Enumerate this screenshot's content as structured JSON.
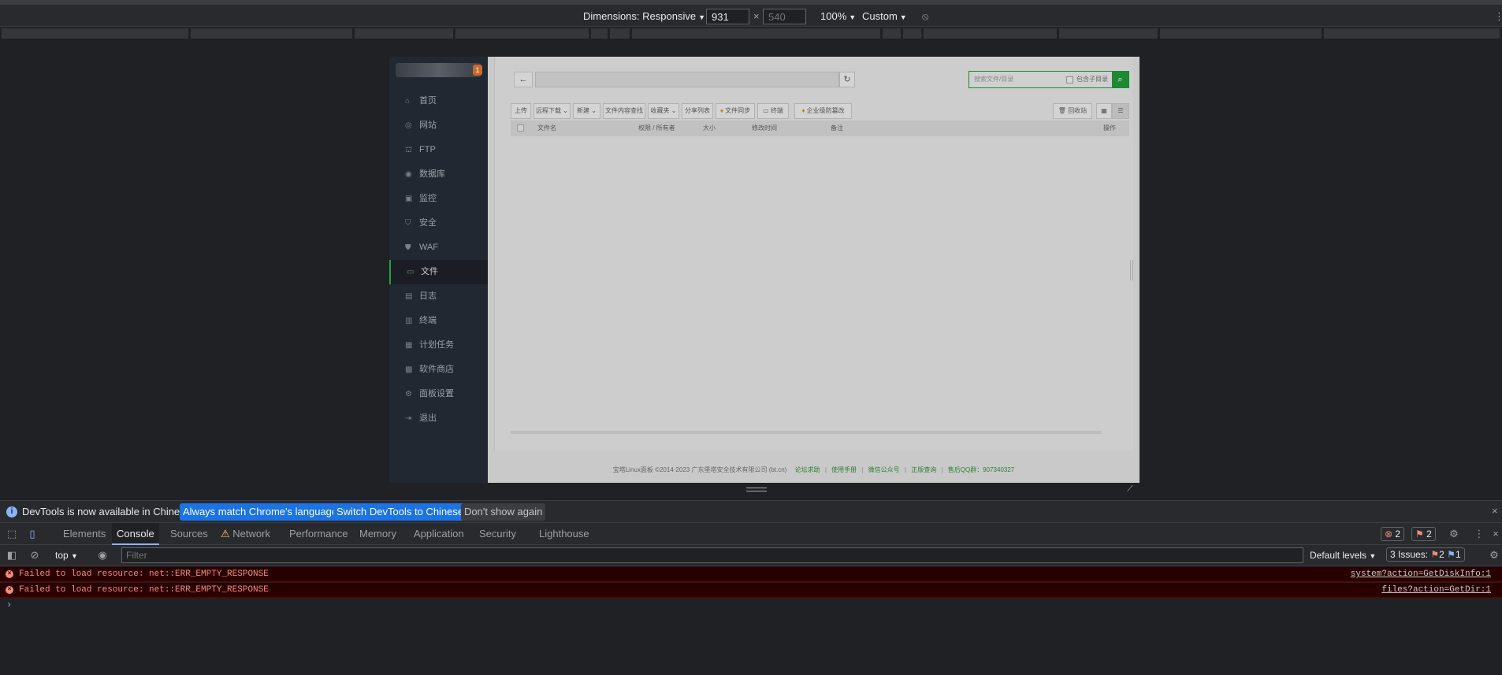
{
  "device_toolbar": {
    "dimensions_label": "Dimensions: Responsive",
    "width_value": "931",
    "height_placeholder": "540",
    "zoom": "100%",
    "throttle": "Custom",
    "more": "⋮"
  },
  "page": {
    "logo_badge": "1",
    "sidebar": [
      {
        "label": "首页",
        "icon": "⌂"
      },
      {
        "label": "网站",
        "icon": "◎"
      },
      {
        "label": "FTP",
        "icon": "⛫"
      },
      {
        "label": "数据库",
        "icon": "◉"
      },
      {
        "label": "监控",
        "icon": "▣"
      },
      {
        "label": "安全",
        "icon": "⛉"
      },
      {
        "label": "WAF",
        "icon": "⛊"
      },
      {
        "label": "文件",
        "icon": "▭"
      },
      {
        "label": "日志",
        "icon": "▤"
      },
      {
        "label": "终端",
        "icon": "▥"
      },
      {
        "label": "计划任务",
        "icon": "▦"
      },
      {
        "label": "软件商店",
        "icon": "▩"
      },
      {
        "label": "面板设置",
        "icon": "⚙"
      },
      {
        "label": "退出",
        "icon": "⇥"
      }
    ],
    "active_nav": "文件",
    "path_back": "←",
    "path_refresh": "↻",
    "search_placeholder": "搜索文件/目录",
    "search_sub_label": "包含子目录",
    "toolbar": {
      "upload": "上传",
      "remote_download": "远程下载",
      "new": "新建",
      "content_search": "文件内容查找",
      "favorites": "收藏夹",
      "share_list": "分享列表",
      "file_sync": "文件同步",
      "terminal": "终端",
      "tamper": "企业级防篡改",
      "recycle": "回收站"
    },
    "table_headers": [
      "文件名",
      "权限 / 所有者",
      "大小",
      "修改时间",
      "备注",
      "操作"
    ],
    "footer": {
      "copyright": "宝塔Linux面板 ©2014-2023 广东堡塔安全技术有限公司 (bt.cn)",
      "links": [
        "论坛求助",
        "使用手册",
        "微信公众号",
        "正版查询"
      ],
      "qq": "售后QQ群：907340327"
    }
  },
  "devtools": {
    "info_message": "DevTools is now available in Chinese!",
    "btn_match": "Always match Chrome's language",
    "btn_switch": "Switch DevTools to Chinese",
    "btn_dont_show": "Don't show again",
    "tabs": [
      "Elements",
      "Console",
      "Sources",
      "Network",
      "Performance",
      "Memory",
      "Application",
      "Security",
      "Lighthouse"
    ],
    "active_tab": "Console",
    "error_count": "2",
    "warning_count": "2",
    "context": "top",
    "filter_placeholder": "Filter",
    "levels": "Default levels",
    "issues_label": "3 Issues:",
    "issues_errors": "2",
    "issues_info": "1",
    "messages": [
      {
        "text": "Failed to load resource: net::ERR_EMPTY_RESPONSE",
        "source": "system?action=GetDiskInfo:1"
      },
      {
        "text": "Failed to load resource: net::ERR_EMPTY_RESPONSE",
        "source": "files?action=GetDir:1"
      }
    ],
    "prompt": "›"
  }
}
